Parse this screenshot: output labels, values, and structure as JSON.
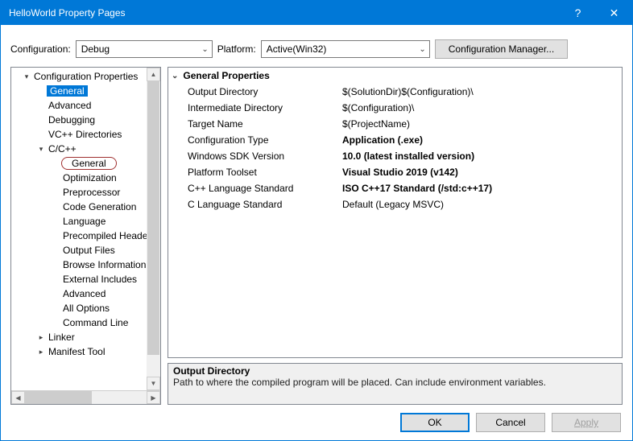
{
  "window": {
    "title": "HelloWorld Property Pages"
  },
  "top": {
    "config_label": "Configuration:",
    "config_value": "Debug",
    "platform_label": "Platform:",
    "platform_value": "Active(Win32)",
    "config_mgr": "Configuration Manager..."
  },
  "tree": [
    {
      "label": "Configuration Properties",
      "arrow": "▾",
      "ind": 1
    },
    {
      "label": "General",
      "ind": 2,
      "selected": true
    },
    {
      "label": "Advanced",
      "ind": 2
    },
    {
      "label": "Debugging",
      "ind": 2
    },
    {
      "label": "VC++ Directories",
      "ind": 2
    },
    {
      "label": "C/C++",
      "arrow": "▾",
      "ind": 2
    },
    {
      "label": "General",
      "ind": 3,
      "circled": true
    },
    {
      "label": "Optimization",
      "ind": 3
    },
    {
      "label": "Preprocessor",
      "ind": 3
    },
    {
      "label": "Code Generation",
      "ind": 3
    },
    {
      "label": "Language",
      "ind": 3
    },
    {
      "label": "Precompiled Headers",
      "ind": 3
    },
    {
      "label": "Output Files",
      "ind": 3
    },
    {
      "label": "Browse Information",
      "ind": 3
    },
    {
      "label": "External Includes",
      "ind": 3
    },
    {
      "label": "Advanced",
      "ind": 3
    },
    {
      "label": "All Options",
      "ind": 3
    },
    {
      "label": "Command Line",
      "ind": 3
    },
    {
      "label": "Linker",
      "arrow": "▸",
      "ind": 2
    },
    {
      "label": "Manifest Tool",
      "arrow": "▸",
      "ind": 2
    }
  ],
  "props": {
    "header": "General Properties",
    "rows": [
      {
        "name": "Output Directory",
        "value": "$(SolutionDir)$(Configuration)\\"
      },
      {
        "name": "Intermediate Directory",
        "value": "$(Configuration)\\"
      },
      {
        "name": "Target Name",
        "value": "$(ProjectName)"
      },
      {
        "name": "Configuration Type",
        "value": "Application (.exe)",
        "bold": true
      },
      {
        "name": "Windows SDK Version",
        "value": "10.0 (latest installed version)",
        "bold": true
      },
      {
        "name": "Platform Toolset",
        "value": "Visual Studio 2019 (v142)",
        "bold": true
      },
      {
        "name": "C++ Language Standard",
        "value": "ISO C++17 Standard (/std:c++17)",
        "bold": true
      },
      {
        "name": "C Language Standard",
        "value": "Default (Legacy MSVC)"
      }
    ]
  },
  "desc": {
    "title": "Output Directory",
    "text": "Path to where the compiled program will be placed. Can include environment variables."
  },
  "buttons": {
    "ok": "OK",
    "cancel": "Cancel",
    "apply": "Apply"
  }
}
